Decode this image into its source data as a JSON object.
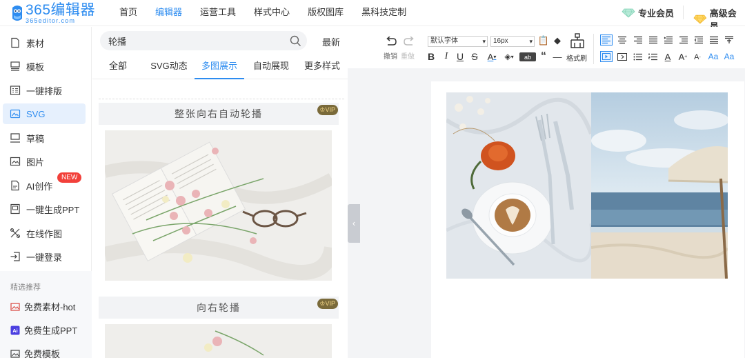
{
  "app": {
    "logo_main": "365编辑器",
    "logo_sub": "365editor.com"
  },
  "nav": [
    "首页",
    "编辑器",
    "运营工具",
    "样式中心",
    "版权图库",
    "黑科技定制"
  ],
  "nav_active": "编辑器",
  "membership": {
    "pro": "专业会员",
    "advanced": "高级会员"
  },
  "sidebar": {
    "items": [
      {
        "label": "素材",
        "icon": "material-icon"
      },
      {
        "label": "模板",
        "icon": "template-icon"
      },
      {
        "label": "一键排版",
        "icon": "layout-icon"
      },
      {
        "label": "SVG",
        "icon": "svg-icon"
      },
      {
        "label": "草稿",
        "icon": "draft-icon"
      },
      {
        "label": "图片",
        "icon": "image-icon"
      },
      {
        "label": "AI创作",
        "icon": "ai-icon"
      },
      {
        "label": "一键生成PPT",
        "icon": "ppt-icon"
      },
      {
        "label": "在线作图",
        "icon": "drawing-icon"
      },
      {
        "label": "一键登录",
        "icon": "login-icon"
      }
    ],
    "active": "SVG",
    "new_badge": "NEW",
    "section_title": "精选推荐",
    "recommend": [
      {
        "label": "免费素材-hot",
        "icon": "free-material-icon"
      },
      {
        "label": "免费生成PPT",
        "icon": "ai-ppt-icon"
      },
      {
        "label": "免费模板",
        "icon": "free-template-icon"
      }
    ]
  },
  "panel": {
    "search_value": "轮播",
    "sort_label": "最新",
    "tabs": [
      "全部",
      "SVG动态",
      "多图展示",
      "自动展现",
      "更多样式"
    ],
    "active_tab": "多图展示",
    "cards": [
      {
        "title": "整张向右自动轮播",
        "badge": "VIP"
      },
      {
        "title": "向右轮播",
        "badge": "VIP"
      }
    ]
  },
  "toolbar": {
    "undo": "撤销",
    "redo": "重做",
    "font_family": "默认字体",
    "font_size": "16px",
    "format_painter": "格式刷"
  },
  "colors": {
    "accent": "#2d8cf0",
    "new_badge": "#f2403a",
    "vip_bg": "#7a6a3a",
    "vip_text": "#f5d889"
  }
}
